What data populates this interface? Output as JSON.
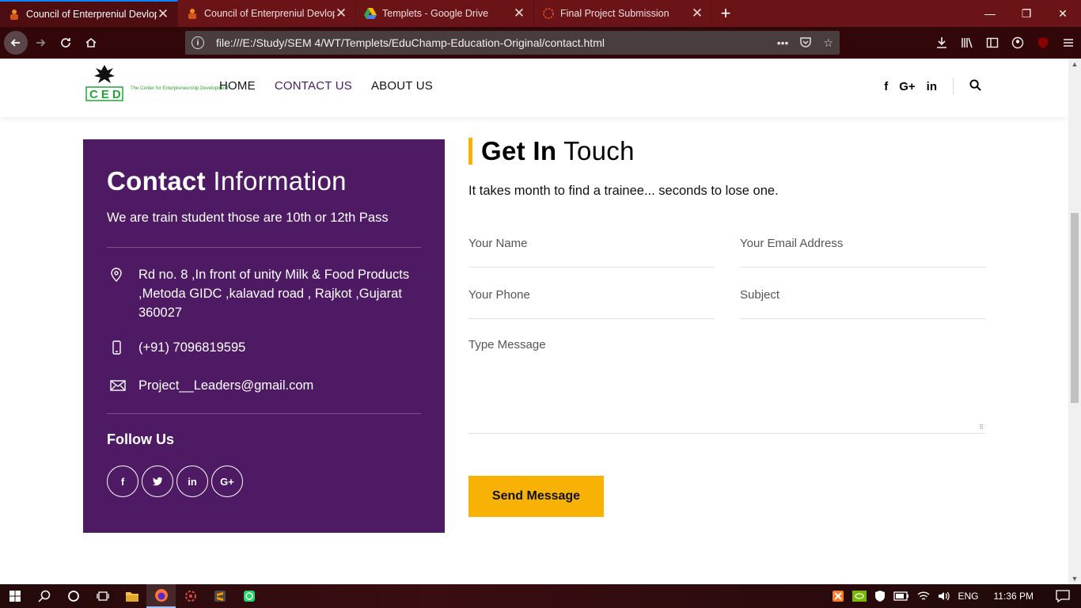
{
  "browser": {
    "tabs": [
      {
        "title": "Council of Enterpreniul Devlopment",
        "active": true
      },
      {
        "title": "Council of Enterpreniul Devlopment",
        "active": false
      },
      {
        "title": "Templets - Google Drive",
        "active": false
      },
      {
        "title": "Final Project Submission",
        "active": false
      }
    ],
    "url": "file:///E:/Study/SEM 4/WT/Templets/EduChamp-Education-Original/contact.html"
  },
  "site": {
    "logo_text": "CED",
    "logo_tagline": "The Center for Enterpreneurship Development",
    "nav": [
      {
        "label": "HOME"
      },
      {
        "label": "CONTACT US"
      },
      {
        "label": "ABOUT US"
      }
    ]
  },
  "contact_info": {
    "title_bold": "Contact",
    "title_rest": " Information",
    "description": "We are train student those are 10th or 12th Pass",
    "address": "Rd no. 8 ,In front of unity Milk & Food Products ,Metoda GIDC ,kalavad road , Rajkot ,Gujarat 360027",
    "phone": "(+91) 7096819595",
    "email": "Project__Leaders@gmail.com",
    "follow_title": "Follow Us"
  },
  "form": {
    "title_bold": "Get In",
    "title_rest": " Touch",
    "lead": "It takes month to find a trainee... seconds to lose one.",
    "name_placeholder": "Your Name",
    "email_placeholder": "Your Email Address",
    "phone_placeholder": "Your Phone",
    "subject_placeholder": "Subject",
    "message_placeholder": "Type Message",
    "submit_label": "Send Message"
  },
  "taskbar": {
    "language": "ENG",
    "time": "11:36 PM"
  },
  "colors": {
    "accent": "#f7b205",
    "panel": "#4d1a63",
    "titlebar": "#6b1418"
  }
}
